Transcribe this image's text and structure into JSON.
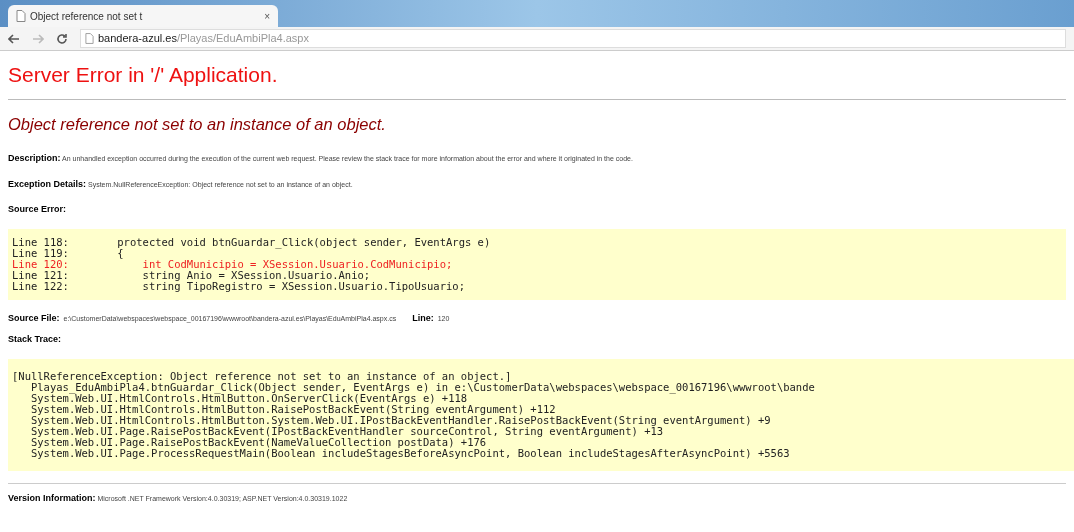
{
  "browser": {
    "tab_title": "Object reference not set t",
    "tab_close": "×",
    "address_host": "bandera-azul.es",
    "address_path": "/Playas/EduAmbiPla4.aspx"
  },
  "page": {
    "title": "Server Error in '/' Application.",
    "subtitle": "Object reference not set to an instance of an object.",
    "description_label": "Description:",
    "description": "An unhandled exception occurred during the execution of the current web request. Please review the stack trace for more information about the error and where it originated in the code.",
    "exception_label": "Exception Details:",
    "exception": "System.NullReferenceException: Object reference not set to an instance of an object.",
    "source_error_label": "Source Error:",
    "source_lines": [
      {
        "number": "Line 118:",
        "code": "    protected void btnGuardar_Click(object sender, EventArgs e)",
        "error": false
      },
      {
        "number": "Line 119:",
        "code": "    {",
        "error": false
      },
      {
        "number": "Line 120:",
        "code": "        int CodMunicipio = XSession.Usuario.CodMunicipio;",
        "error": true
      },
      {
        "number": "Line 121:",
        "code": "        string Anio = XSession.Usuario.Anio;",
        "error": false
      },
      {
        "number": "Line 122:",
        "code": "        string TipoRegistro = XSession.Usuario.TipoUsuario;",
        "error": false
      }
    ],
    "source_file_label": "Source File:",
    "source_file": "e:\\CustomerData\\webspaces\\webspace_00167196\\wwwroot\\bandera-azul.es\\Playas\\EduAmbiPla4.aspx.cs",
    "line_label": "Line:",
    "line": "120",
    "stack_trace_label": "Stack Trace:",
    "stack_trace": [
      "[NullReferenceException: Object reference not set to an instance of an object.]",
      "   Playas_EduAmbiPla4.btnGuardar_Click(Object sender, EventArgs e) in e:\\CustomerData\\webspaces\\webspace_00167196\\wwwroot\\bande",
      "   System.Web.UI.HtmlControls.HtmlButton.OnServerClick(EventArgs e) +118",
      "   System.Web.UI.HtmlControls.HtmlButton.RaisePostBackEvent(String eventArgument) +112",
      "   System.Web.UI.HtmlControls.HtmlButton.System.Web.UI.IPostBackEventHandler.RaisePostBackEvent(String eventArgument) +9",
      "   System.Web.UI.Page.RaisePostBackEvent(IPostBackEventHandler sourceControl, String eventArgument) +13",
      "   System.Web.UI.Page.RaisePostBackEvent(NameValueCollection postData) +176",
      "   System.Web.UI.Page.ProcessRequestMain(Boolean includeStagesBeforeAsyncPoint, Boolean includeStagesAfterAsyncPoint) +5563"
    ],
    "version_label": "Version Information:",
    "version": "Microsoft .NET Framework Version:4.0.30319; ASP.NET Version:4.0.30319.1022"
  }
}
